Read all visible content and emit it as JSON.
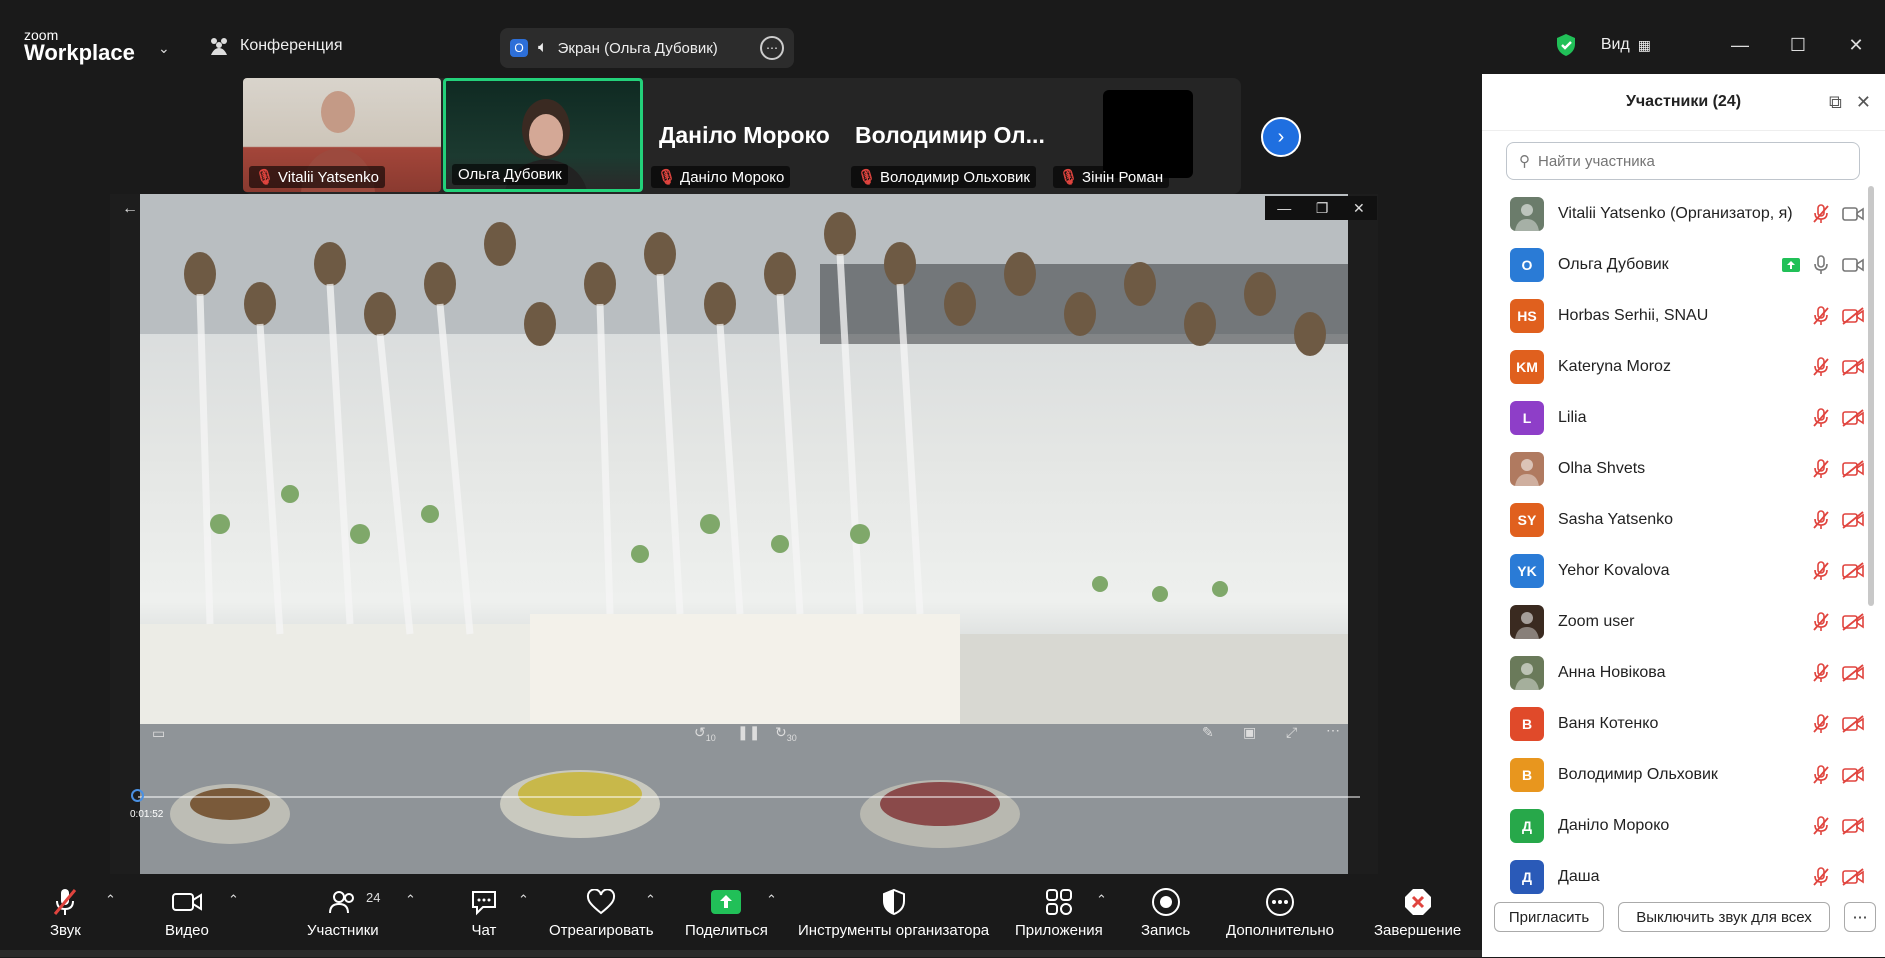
{
  "app": {
    "logo_small": "zoom",
    "logo_big": "Workplace"
  },
  "header": {
    "conference_label": "Конференция",
    "screen_share_label": "Экран (Ольга Дубовик)",
    "view_label": "Вид"
  },
  "gallery": {
    "tiles": [
      {
        "name": "Vitalii Yatsenko",
        "muted": true,
        "type": "video"
      },
      {
        "name": "Ольга Дубовик",
        "muted": false,
        "type": "video",
        "active_speaker": true
      },
      {
        "name": "Даніло Мороко",
        "big_name": "Даніло Мороко",
        "muted": true,
        "type": "name"
      },
      {
        "name": "Володимир Ольховик",
        "big_name": "Володимир  Ол...",
        "muted": true,
        "type": "name"
      },
      {
        "name": "Зінін Роман",
        "muted": true,
        "type": "dark"
      }
    ]
  },
  "player": {
    "timestamp": "0:01:52",
    "rewind_label": "10",
    "forward_label": "30",
    "progress": 0.0
  },
  "participants": {
    "title": "Участники (24)",
    "search_placeholder": "Найти участника",
    "list": [
      {
        "name": "Vitalii Yatsenko (Организатор, я)",
        "initials": "",
        "color": "#6b7c6b",
        "photo": true,
        "mic": "muted",
        "video": "off"
      },
      {
        "name": "Ольга Дубовик",
        "initials": "О",
        "color": "#2a7bd6",
        "photo": false,
        "mic": "on",
        "video": "off",
        "sharing": true
      },
      {
        "name": "Horbas Serhii, SNAU",
        "initials": "HS",
        "color": "#e0601e",
        "photo": false,
        "mic": "muted",
        "video": "muted"
      },
      {
        "name": "Kateryna Moroz",
        "initials": "KM",
        "color": "#e0601e",
        "photo": false,
        "mic": "muted",
        "video": "muted"
      },
      {
        "name": "Lilia",
        "initials": "L",
        "color": "#8e3ec8",
        "photo": false,
        "mic": "muted",
        "video": "muted"
      },
      {
        "name": "Olha Shvets",
        "initials": "",
        "color": "#b07a60",
        "photo": true,
        "mic": "muted",
        "video": "muted"
      },
      {
        "name": "Sasha Yatsenko",
        "initials": "SY",
        "color": "#e0601e",
        "photo": false,
        "mic": "muted",
        "video": "muted"
      },
      {
        "name": "Yehor Kovalova",
        "initials": "YK",
        "color": "#2a7bd6",
        "photo": false,
        "mic": "muted",
        "video": "muted"
      },
      {
        "name": "Zoom user",
        "initials": "",
        "color": "#3a2a20",
        "photo": true,
        "mic": "muted",
        "video": "muted"
      },
      {
        "name": "Анна Новікова",
        "initials": "",
        "color": "#6a7a5a",
        "photo": true,
        "mic": "muted",
        "video": "muted"
      },
      {
        "name": "Ваня Котенко",
        "initials": "В",
        "color": "#e04a2a",
        "photo": false,
        "mic": "muted",
        "video": "muted"
      },
      {
        "name": "Володимир Ольховик",
        "initials": "В",
        "color": "#e8961e",
        "photo": false,
        "mic": "muted",
        "video": "muted"
      },
      {
        "name": "Даніло Мороко",
        "initials": "Д",
        "color": "#27a84a",
        "photo": false,
        "mic": "muted",
        "video": "muted"
      },
      {
        "name": "Даша",
        "initials": "Д",
        "color": "#2a5ab8",
        "photo": false,
        "mic": "muted",
        "video": "muted"
      }
    ],
    "invite_label": "Пригласить",
    "mute_all_label": "Выключить звук для всех"
  },
  "toolbar": {
    "audio": "Звук",
    "video": "Видео",
    "participants": "Участники",
    "participants_count": "24",
    "chat": "Чат",
    "react": "Отреагировать",
    "share": "Поделиться",
    "host_tools": "Инструменты организатора",
    "apps": "Приложения",
    "record": "Запись",
    "more": "Дополнительно",
    "end": "Завершение"
  },
  "colors": {
    "accent": "#2d8cff",
    "share_green": "#21c058",
    "muted_red": "#e0443e",
    "speaker_border": "#23d17a"
  }
}
